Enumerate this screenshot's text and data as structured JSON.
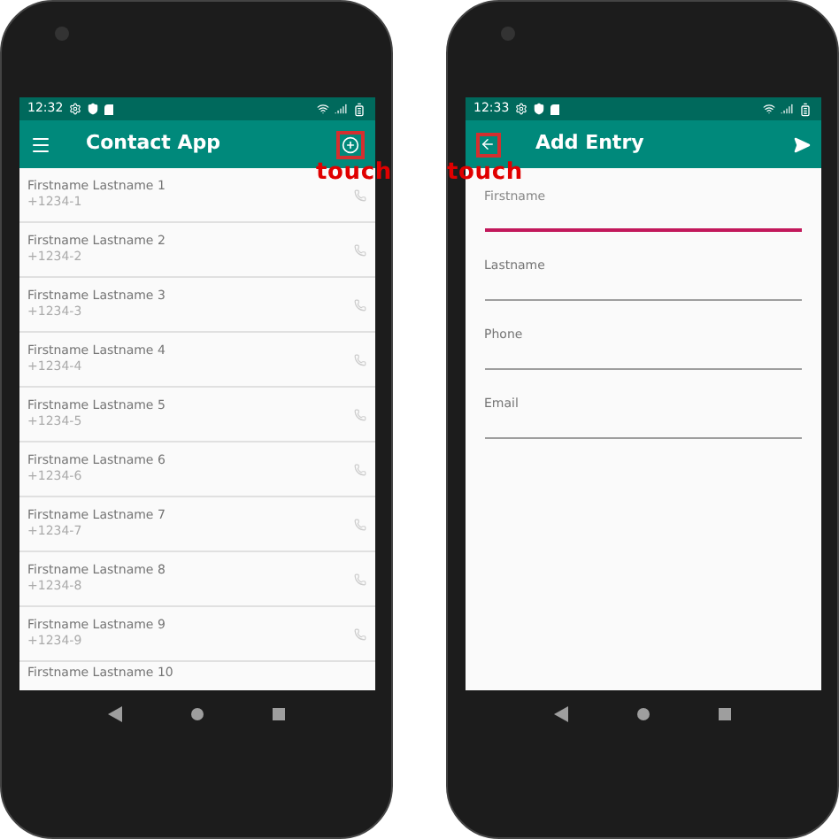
{
  "left_phone": {
    "status_bar": {
      "time": "12:32"
    },
    "app_bar": {
      "kind": "list",
      "title": "Contact App"
    },
    "touch_label": "touch",
    "contacts": [
      {
        "name": "Firstname Lastname 1",
        "phone": "+1234-1"
      },
      {
        "name": "Firstname Lastname 2",
        "phone": "+1234-2"
      },
      {
        "name": "Firstname Lastname 3",
        "phone": "+1234-3"
      },
      {
        "name": "Firstname Lastname 4",
        "phone": "+1234-4"
      },
      {
        "name": "Firstname Lastname 5",
        "phone": "+1234-5"
      },
      {
        "name": "Firstname Lastname 6",
        "phone": "+1234-6"
      },
      {
        "name": "Firstname Lastname 7",
        "phone": "+1234-7"
      },
      {
        "name": "Firstname Lastname 8",
        "phone": "+1234-8"
      },
      {
        "name": "Firstname Lastname 9",
        "phone": "+1234-9"
      }
    ],
    "partial_contact": {
      "name": "Firstname Lastname 10"
    }
  },
  "right_phone": {
    "status_bar": {
      "time": "12:33"
    },
    "app_bar": {
      "kind": "form",
      "title": "Add Entry"
    },
    "touch_label": "touch",
    "fields": [
      {
        "label": "Firstname",
        "focused": true
      },
      {
        "label": "Lastname",
        "focused": false
      },
      {
        "label": "Phone",
        "focused": false
      },
      {
        "label": "Email",
        "focused": false
      }
    ]
  }
}
